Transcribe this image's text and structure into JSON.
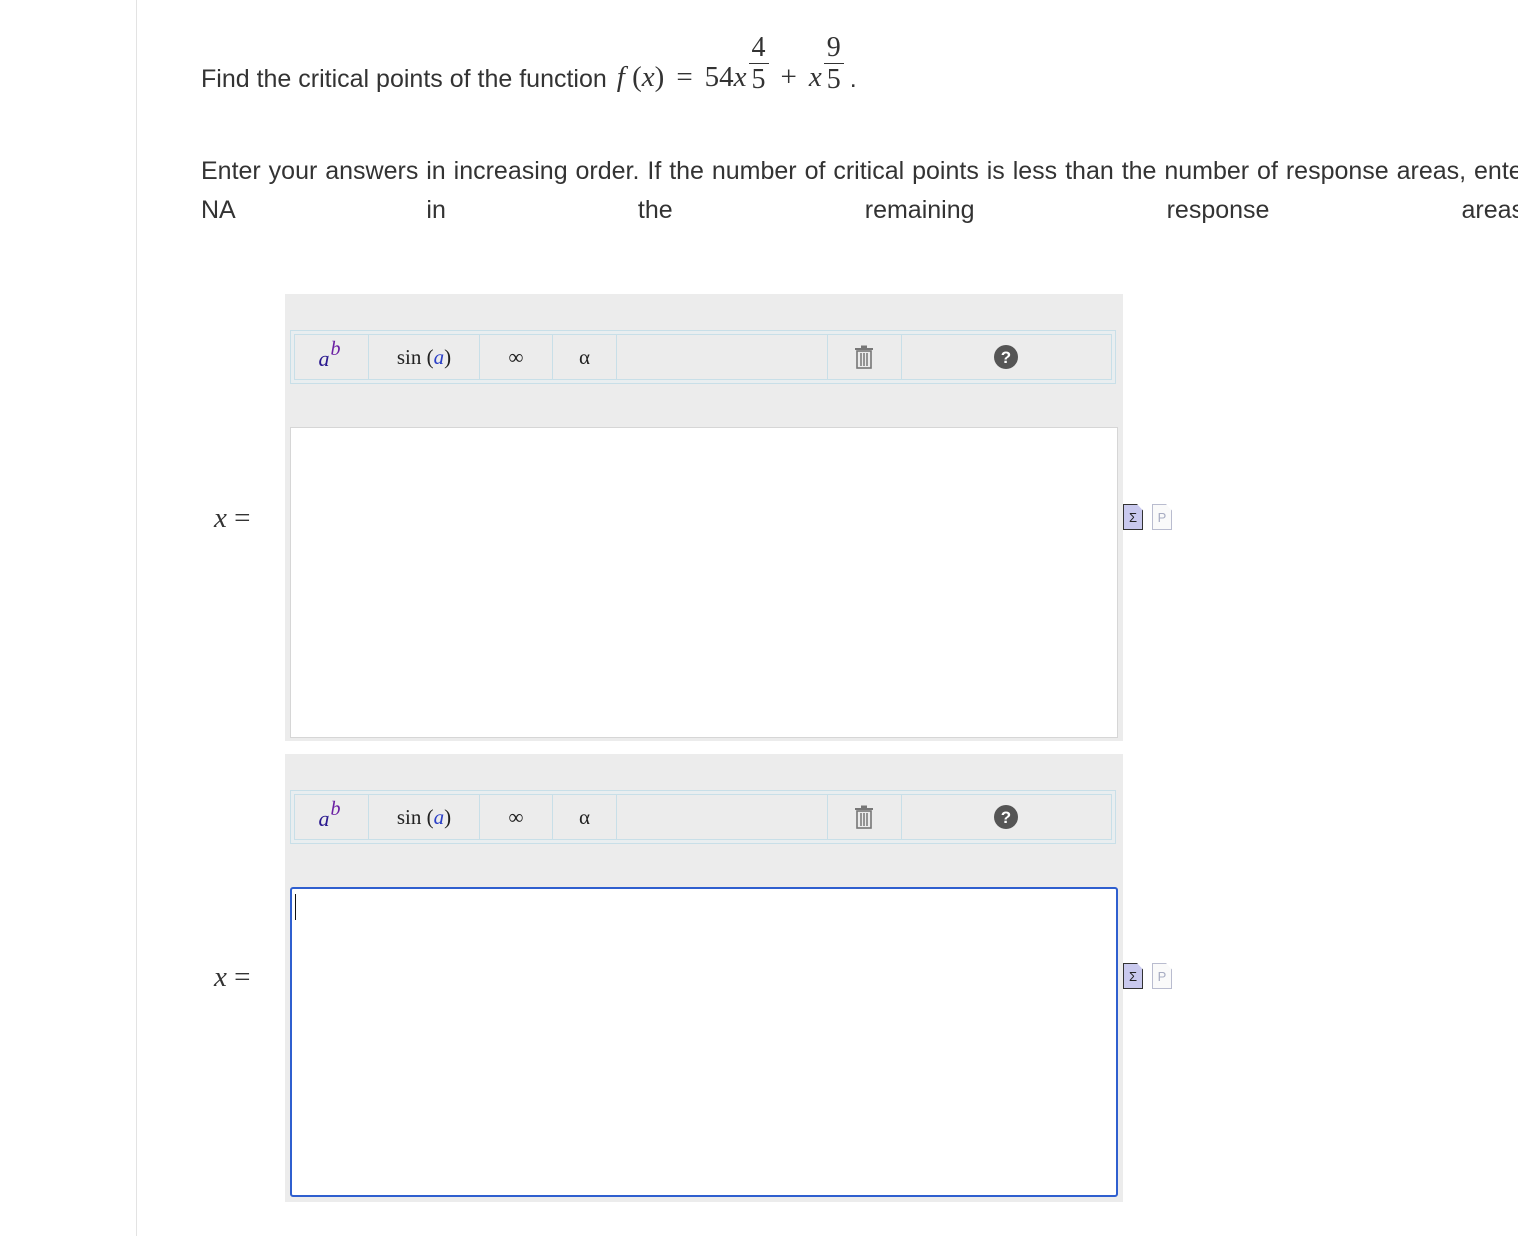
{
  "question": {
    "prompt": "Find the critical points of the function",
    "func": "f",
    "var": "x",
    "equals": "=",
    "coef": "54",
    "exp1_num": "4",
    "exp1_den": "5",
    "plus": "+",
    "exp2_num": "9",
    "exp2_den": "5",
    "end": "."
  },
  "instructions": "Enter your answers in increasing order. If the number of critical points is less than the number of response areas, enter NA in the remaining response areas.",
  "toolbar": {
    "power_base": "a",
    "power_exp": "b",
    "sin_fn": "sin",
    "sin_arg": "a",
    "infinity": "∞",
    "alpha": "α",
    "help": "?"
  },
  "answers": [
    {
      "label_var": "x",
      "label_eq": "=",
      "value": "",
      "focused": false
    },
    {
      "label_var": "x",
      "label_eq": "=",
      "value": "",
      "focused": true
    }
  ],
  "side_icons": {
    "sigma": "Σ",
    "p": "P"
  }
}
